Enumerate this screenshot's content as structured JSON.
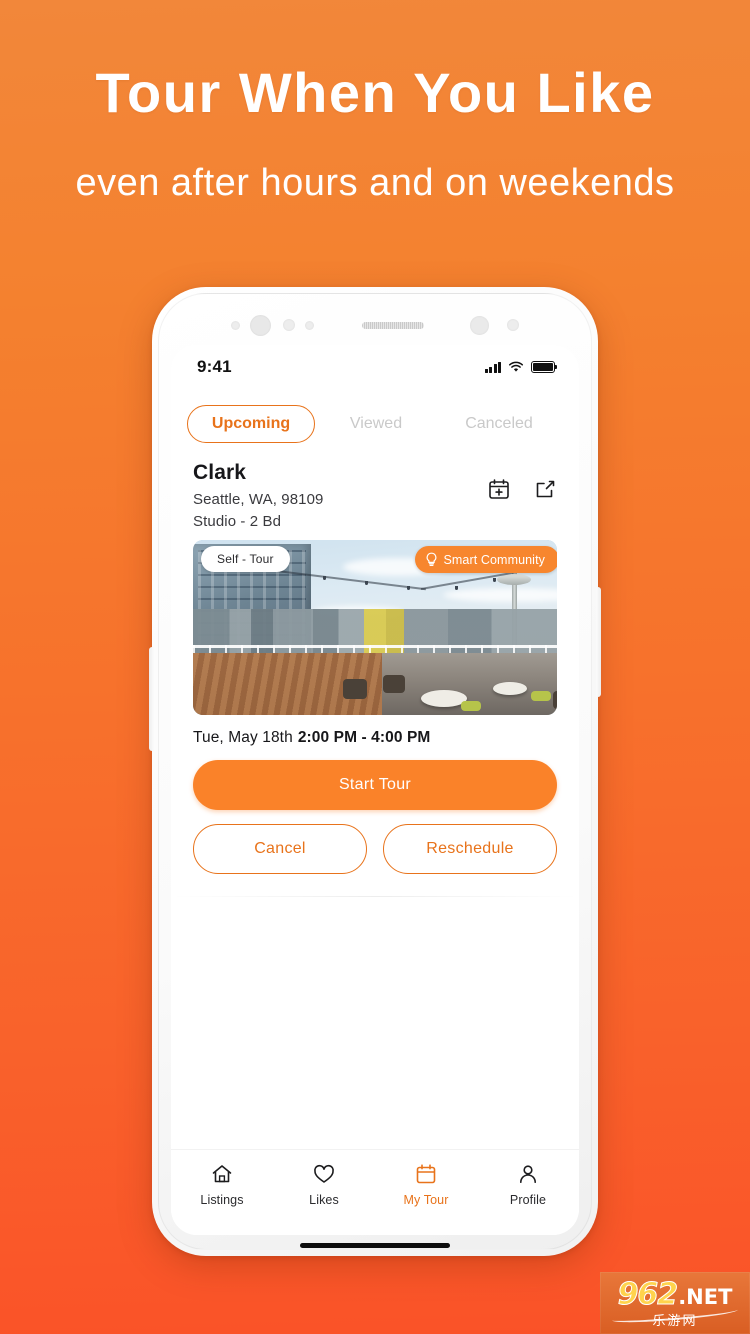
{
  "promo": {
    "headline": "Tour When You Like",
    "subheadline": "even after hours and on weekends"
  },
  "colors": {
    "bg_top": "#F2873A",
    "bg_bottom": "#FA5228",
    "accent": "#E8731B",
    "button_fill": "#FA8229",
    "badge_smart": "#F7862E",
    "tab_inactive": "#C9C9C9"
  },
  "phone": {
    "status_bar": {
      "time": "9:41",
      "signal_icon": "cellular-signal-icon",
      "wifi_icon": "wifi-icon",
      "battery_icon": "battery-full-icon"
    },
    "tabs": [
      {
        "label": "Upcoming",
        "active": true
      },
      {
        "label": "Viewed",
        "active": false
      },
      {
        "label": "Canceled",
        "active": false
      }
    ],
    "listing": {
      "title": "Clark",
      "address": "Seattle, WA, 98109",
      "unit_types": "Studio - 2 Bd",
      "actions": [
        {
          "name": "add-to-calendar-icon",
          "label": "Add to calendar"
        },
        {
          "name": "share-icon",
          "label": "Share"
        }
      ],
      "photo": {
        "alt": "Rooftop terrace with Seattle skyline and Space Needle",
        "badge_self_tour": "Self - Tour",
        "badge_smart_community": "Smart Community",
        "badge_smart_icon": "lightbulb-icon"
      },
      "appointment": {
        "date": "Tue, May 18th",
        "time_range": "2:00 PM - 4:00 PM"
      },
      "buttons": {
        "primary": "Start Tour",
        "cancel": "Cancel",
        "reschedule": "Reschedule"
      }
    },
    "bottom_nav": [
      {
        "label": "Listings",
        "icon": "home-icon",
        "active": false
      },
      {
        "label": "Likes",
        "icon": "heart-icon",
        "active": false
      },
      {
        "label": "My Tour",
        "icon": "calendar-icon",
        "active": true
      },
      {
        "label": "Profile",
        "icon": "person-icon",
        "active": false
      }
    ]
  },
  "watermark": {
    "number": "962",
    "tld": ".NET",
    "chinese": "乐游网"
  }
}
